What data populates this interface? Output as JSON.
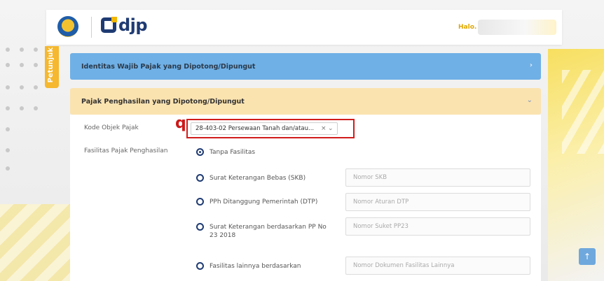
{
  "header": {
    "logo_text": "djp",
    "greeting": "Halo."
  },
  "side_tab": {
    "label": "Petunjuk"
  },
  "panels": {
    "identitas": {
      "title": "Identitas Wajib Pajak yang Dipotong/Dipungut",
      "icon": "chevron-right-icon"
    },
    "pph": {
      "title": "Pajak Penghasilan yang Dipotong/Dipungut",
      "icon": "chevron-down-icon"
    }
  },
  "form": {
    "kode_objek": {
      "label": "Kode Objek Pajak",
      "marker": "q",
      "selected": "28-403-02 Persewaan Tanah dan/atau...",
      "clear_glyph": "×",
      "caret_glyph": "⌄"
    },
    "fasilitas": {
      "label": "Fasilitas Pajak Penghasilan",
      "options": [
        {
          "label": "Tanpa Fasilitas",
          "selected": true,
          "placeholder": ""
        },
        {
          "label": "Surat Keterangan Bebas (SKB)",
          "selected": false,
          "placeholder": "Nomor SKB"
        },
        {
          "label": "PPh Ditanggung Pemerintah (DTP)",
          "selected": false,
          "placeholder": "Nomor Aturan DTP"
        },
        {
          "label": "Surat Keterangan berdasarkan PP No 23 2018",
          "selected": false,
          "placeholder": "Nomor Suket PP23"
        },
        {
          "label": "Fasilitas lainnya berdasarkan",
          "selected": false,
          "placeholder": "Nomor Dokumen Fasilitas Lainnya"
        }
      ]
    }
  },
  "scroll_top": {
    "glyph": "↑"
  },
  "colors": {
    "brand_navy": "#1f3b73",
    "accent_yellow": "#f5b82e",
    "panel_blue": "#6fb0e6",
    "panel_cream": "#fbe3b0",
    "highlight_red": "#d11c1c"
  }
}
